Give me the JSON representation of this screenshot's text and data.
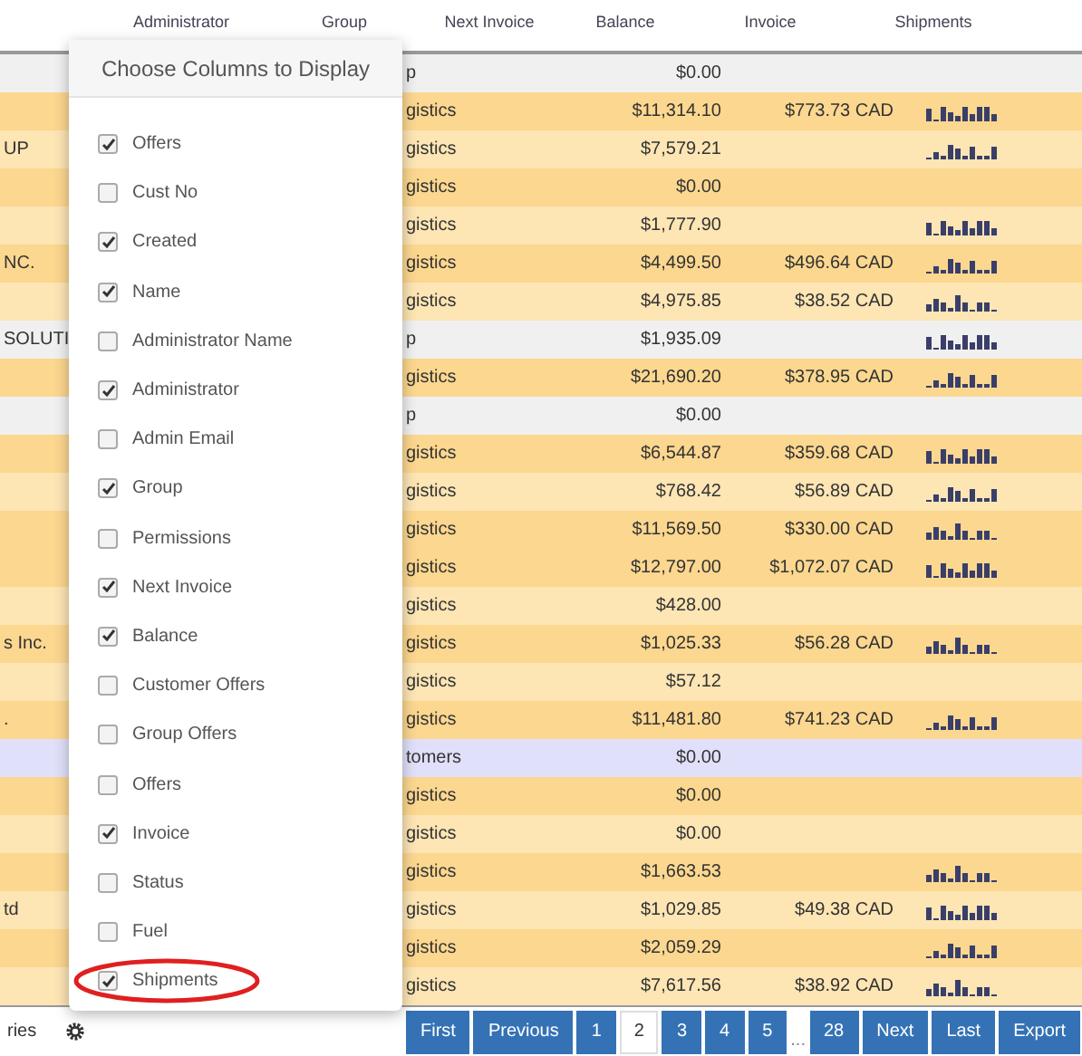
{
  "table": {
    "columns": [
      "Administrator",
      "Group",
      "Next Invoice",
      "Balance",
      "Invoice",
      "Shipments"
    ],
    "rows": [
      {
        "col_1": "",
        "group": "p",
        "balance": "$0.00",
        "invoice": "",
        "color": "#f0f0f0",
        "sparkline": false
      },
      {
        "col_1": "",
        "group": "gistics",
        "balance": "$11,314.10",
        "invoice": "$773.73 CAD",
        "color": "#fcd78f",
        "sparkline": true
      },
      {
        "col_1": "UP",
        "group": "gistics",
        "balance": "$7,579.21",
        "invoice": "",
        "color": "#fde5b4",
        "sparkline": true
      },
      {
        "col_1": "",
        "group": "gistics",
        "balance": "$0.00",
        "invoice": "",
        "color": "#fcd78f",
        "sparkline": false
      },
      {
        "col_1": "",
        "group": "gistics",
        "balance": "$1,777.90",
        "invoice": "",
        "color": "#fde5b4",
        "sparkline": true
      },
      {
        "col_1": "NC.",
        "group": "gistics",
        "balance": "$4,499.50",
        "invoice": "$496.64 CAD",
        "color": "#fcd78f",
        "sparkline": true
      },
      {
        "col_1": "",
        "group": "gistics",
        "balance": "$4,975.85",
        "invoice": "$38.52 CAD",
        "color": "#fde5b4",
        "sparkline": true
      },
      {
        "col_1": "SOLUTI",
        "group": "p",
        "balance": "$1,935.09",
        "invoice": "",
        "color": "#f0f0f0",
        "sparkline": true
      },
      {
        "col_1": "",
        "group": "gistics",
        "balance": "$21,690.20",
        "invoice": "$378.95 CAD",
        "color": "#fcd78f",
        "sparkline": true
      },
      {
        "col_1": "",
        "group": "p",
        "balance": "$0.00",
        "invoice": "",
        "color": "#f0f0f0",
        "sparkline": false
      },
      {
        "col_1": "",
        "group": "gistics",
        "balance": "$6,544.87",
        "invoice": "$359.68 CAD",
        "color": "#fcd78f",
        "sparkline": true
      },
      {
        "col_1": "",
        "group": "gistics",
        "balance": "$768.42",
        "invoice": "$56.89 CAD",
        "color": "#fde5b4",
        "sparkline": true
      },
      {
        "col_1": "",
        "group": "gistics",
        "balance": "$11,569.50",
        "invoice": "$330.00 CAD",
        "color": "#fcd78f",
        "sparkline": true
      },
      {
        "col_1": "",
        "group": "gistics",
        "balance": "$12,797.00",
        "invoice": "$1,072.07 CAD",
        "color": "#fcd78f",
        "sparkline": true
      },
      {
        "col_1": "",
        "group": "gistics",
        "balance": "$428.00",
        "invoice": "",
        "color": "#fde5b4",
        "sparkline": false
      },
      {
        "col_1": "s Inc.",
        "group": "gistics",
        "balance": "$1,025.33",
        "invoice": "$56.28 CAD",
        "color": "#fcd78f",
        "sparkline": true
      },
      {
        "col_1": "",
        "group": "gistics",
        "balance": "$57.12",
        "invoice": "",
        "color": "#fde5b4",
        "sparkline": false
      },
      {
        "col_1": ".",
        "group": "gistics",
        "balance": "$11,481.80",
        "invoice": "$741.23 CAD",
        "color": "#fcd78f",
        "sparkline": true
      },
      {
        "col_1": "",
        "group": "tomers",
        "balance": "$0.00",
        "invoice": "",
        "color": "#e0e0fa",
        "sparkline": false
      },
      {
        "col_1": "",
        "group": "gistics",
        "balance": "$0.00",
        "invoice": "",
        "color": "#fcd78f",
        "sparkline": false
      },
      {
        "col_1": "",
        "group": "gistics",
        "balance": "$0.00",
        "invoice": "",
        "color": "#fde5b4",
        "sparkline": false
      },
      {
        "col_1": "",
        "group": "gistics",
        "balance": "$1,663.53",
        "invoice": "",
        "color": "#fcd78f",
        "sparkline": true
      },
      {
        "col_1": "td",
        "group": "gistics",
        "balance": "$1,029.85",
        "invoice": "$49.38 CAD",
        "color": "#fde5b4",
        "sparkline": true
      },
      {
        "col_1": "",
        "group": "gistics",
        "balance": "$2,059.29",
        "invoice": "",
        "color": "#fcd78f",
        "sparkline": true
      },
      {
        "col_1": "",
        "group": "gistics",
        "balance": "$7,617.56",
        "invoice": "$38.92 CAD",
        "color": "#fde5b4",
        "sparkline": true
      }
    ]
  },
  "footer": {
    "text": "ries"
  },
  "pagination": [
    {
      "label": "First",
      "selected": false
    },
    {
      "label": "Previous",
      "selected": false
    },
    {
      "label": "1",
      "selected": false
    },
    {
      "label": "2",
      "selected": true
    },
    {
      "label": "3",
      "selected": false
    },
    {
      "label": "4",
      "selected": false
    },
    {
      "label": "5",
      "selected": false
    },
    {
      "label": "...",
      "kind": "gap"
    },
    {
      "label": "28",
      "selected": false
    },
    {
      "label": "Next",
      "selected": false
    },
    {
      "label": "Last",
      "selected": false
    },
    {
      "label": "Export",
      "selected": false
    }
  ],
  "column_chooser": {
    "title": "Choose Columns to Display",
    "options": [
      {
        "label": "Offers",
        "checked": true
      },
      {
        "label": "Cust No",
        "checked": false
      },
      {
        "label": "Created",
        "checked": true
      },
      {
        "label": "Name",
        "checked": true
      },
      {
        "label": "Administrator Name",
        "checked": false
      },
      {
        "label": "Administrator",
        "checked": true
      },
      {
        "label": "Admin Email",
        "checked": false
      },
      {
        "label": "Group",
        "checked": true
      },
      {
        "label": "Permissions",
        "checked": false
      },
      {
        "label": "Next Invoice",
        "checked": true
      },
      {
        "label": "Balance",
        "checked": true
      },
      {
        "label": "Customer Offers",
        "checked": false
      },
      {
        "label": "Group Offers",
        "checked": false
      },
      {
        "label": "Offers",
        "checked": false
      },
      {
        "label": "Invoice",
        "checked": true
      },
      {
        "label": "Status",
        "checked": false
      },
      {
        "label": "Fuel",
        "checked": false
      },
      {
        "label": "Shipments",
        "checked": true,
        "highlighted": true
      }
    ]
  }
}
